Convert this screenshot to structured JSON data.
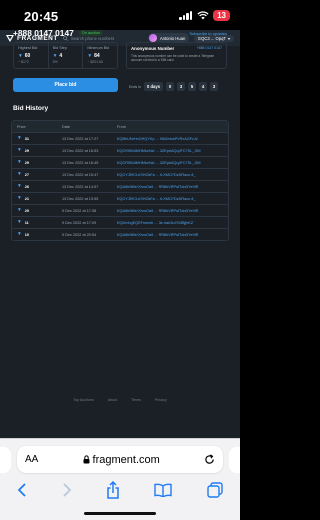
{
  "status_bar": {
    "time": "20:45",
    "battery": "13"
  },
  "nav": {
    "logo": "FRAGMENT",
    "search_placeholder": "Search phone numbers",
    "username": "Antonio Huan",
    "wallet": "EQC3 ... OpqT"
  },
  "number": {
    "value": "+888 0147 0147",
    "status_badge": "On auction",
    "subscribe": "Subscribe to updates"
  },
  "stats": [
    {
      "label": "Highest Bid",
      "value": "60",
      "usd": "~ $172"
    },
    {
      "label": "Bid Step",
      "value": "4",
      "usd": "5%"
    },
    {
      "label": "Minimum Bid",
      "value": "84",
      "usd": "~ $201.60"
    }
  ],
  "anonymous": {
    "title": "Anonymous Number",
    "number": "+888 0147 0147",
    "description": "This anonymous number can be used to create a Telegram account not tied to a SIM card."
  },
  "place_bid": "Place bid",
  "ends": {
    "label": "Ends in",
    "days": "0 days",
    "digits": [
      "0",
      "3",
      "5",
      "4",
      "3"
    ]
  },
  "bid_history": {
    "title": "Bid History",
    "columns": [
      "Price",
      "Date",
      "From"
    ],
    "rows": [
      {
        "price": "31",
        "date": "13 Dec 2022 at 17:27",
        "from": "EQBhUNrHnOHQYKp ... 0lbZmbaPVRxAGFcJz"
      },
      {
        "price": "29",
        "date": "13 Dec 2022 at 16:53",
        "from": "EQCR5B4tMHMbzNsI ... 3ZEpbAQqJFC7SL_GM"
      },
      {
        "price": "29",
        "date": "13 Dec 2022 at 16:45",
        "from": "EQCR5B4tMHMbzNsI ... 3ZEpbAQqJFC7SL_GM"
      },
      {
        "price": "27",
        "date": "13 Dec 2022 at 15:47",
        "from": "EQCYJEfCLhSHOkFa ... ILXMO7DzDRacn-fl_"
      },
      {
        "price": "26",
        "date": "13 Dec 2022 at 14:57",
        "from": "EQA6hMBsY0vwOa9 ... RR8hVRPsfTubDYe9IR"
      },
      {
        "price": "21",
        "date": "13 Dec 2022 at 13:55",
        "from": "EQCYJEfCLhSHOkFa ... ILXMO7DzDRacn-fl_"
      },
      {
        "price": "20",
        "date": "9 Dec 2022 at 17:38",
        "from": "EQA6hMBsY0vwOa9 ... RR8hVRPsfTubDYe9IR"
      },
      {
        "price": "11",
        "date": "9 Dec 2022 at 17:09",
        "from": "EQDmhgEQEFneezb ... 3e-irab3uYN3BjjbKZ"
      },
      {
        "price": "10",
        "date": "9 Dec 2022 at 20:54",
        "from": "EQA6hMBsY0vwOa9 ... RR8hVRPsfTubDYe9IR"
      }
    ]
  },
  "footer": [
    "Top Auctions",
    "About",
    "Terms",
    "Privacy"
  ],
  "safari": {
    "aa": "AA",
    "url": "fragment.com"
  }
}
